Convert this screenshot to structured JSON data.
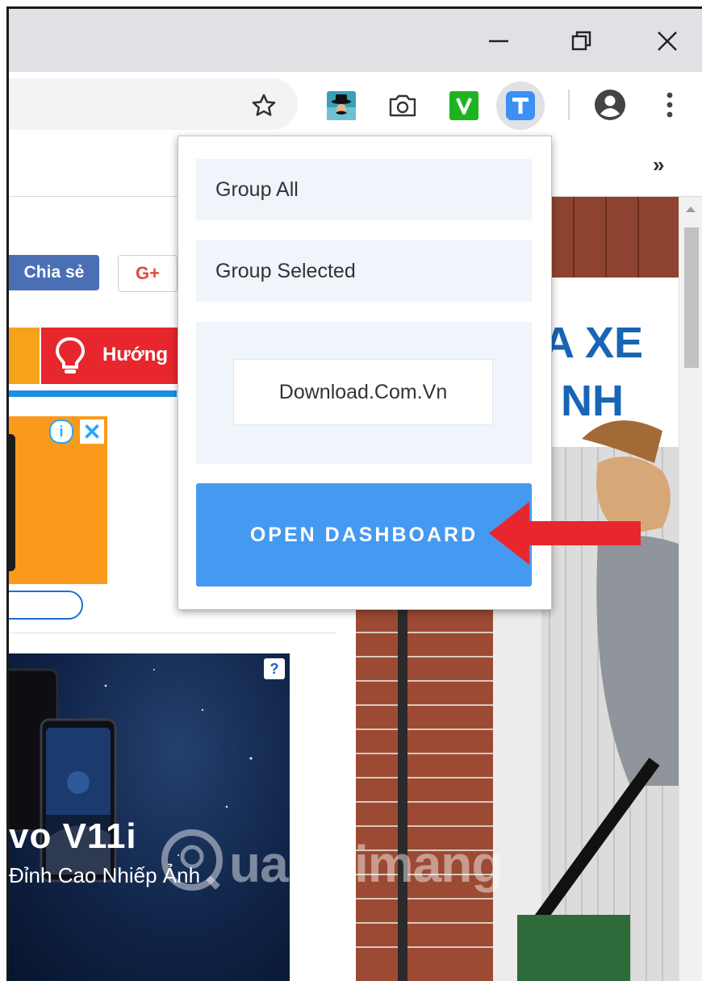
{
  "bookmarks": {
    "overflow_label": "»"
  },
  "page": {
    "share_label": "Chia sẻ",
    "gplus_label": "G+",
    "nav_tab_label": "Hướng",
    "ad_info": "i",
    "ad_close": "✕",
    "vivo_ad": {
      "question": "?",
      "title": "vo V11i",
      "subtitle": "Đỉnh Cao Nhiếp Ảnh"
    },
    "photo_sign_line1": "A XE",
    "photo_sign_line2": "NH",
    "watermark": "uantrimang"
  },
  "popup": {
    "group_all": "Group All",
    "group_selected": "Group Selected",
    "group_name": "Download.Com.Vn",
    "open_dashboard": "OPEN DASHBOARD"
  },
  "colors": {
    "popup_button": "#4599f0",
    "popup_item_bg": "#f0f4fb",
    "arrow": "#e8262d",
    "extension_t": "#3b8ff5",
    "extension_v": "#1fb41f"
  }
}
